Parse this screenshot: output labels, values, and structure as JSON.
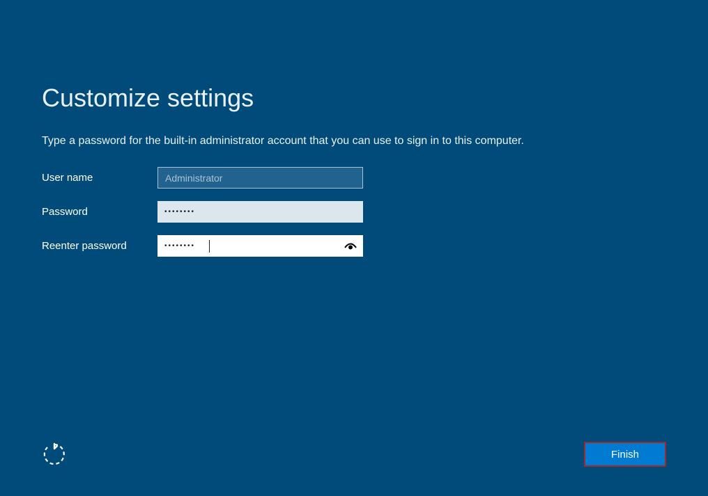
{
  "title": "Customize settings",
  "instruction": "Type a password for the built-in administrator account that you can use to sign in to this computer.",
  "form": {
    "username_label": "User name",
    "username_value": "Administrator",
    "password_label": "Password",
    "password_value": "••••••••",
    "reenter_label": "Reenter password",
    "reenter_value": "••••••••"
  },
  "buttons": {
    "finish": "Finish"
  }
}
